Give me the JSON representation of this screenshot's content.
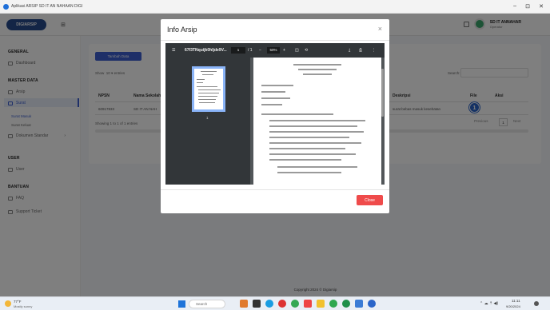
{
  "window": {
    "title": "Aplikasi ARSIP SD IT AN NAHAAN DIGI",
    "controls": [
      "–",
      "⊡",
      "✕"
    ]
  },
  "header": {
    "logo_text": "DIGIARSIP",
    "logo_sub": "⊞",
    "user_name": "SD IT ANNAHAR",
    "user_role": "Operator"
  },
  "sidebar": {
    "sections": [
      {
        "head": "GENERAL",
        "items": [
          "Dashboard"
        ]
      },
      {
        "head": "MASTER DATA",
        "items": [
          "Arsip",
          "Surat"
        ]
      },
      {
        "head": "USER",
        "items": [
          "User"
        ]
      },
      {
        "head": "BANTUAN",
        "items": [
          "FAQ",
          "Support Ticket"
        ]
      }
    ],
    "sub_items": [
      "Surat Masuk",
      "Surat Keluar",
      "Dokumen Standar"
    ]
  },
  "main": {
    "add_button": "Tambah Data",
    "show_label": "Show",
    "show_value": "10",
    "entries_label": "entries",
    "search_label": "Search:",
    "columns": [
      "NPSN",
      "Nama Sekolah",
      "Deskripsi",
      "File",
      "Aksi"
    ],
    "row": {
      "npsn": "60917833",
      "nama": "SD IT AN NAH",
      "deskripsi": "surat bebas masuk kesehatan"
    },
    "info": "Showing 1 to 1 of 1 entries",
    "prev": "Previous",
    "page": "1",
    "next": "Next",
    "badge": "1",
    "footer": "Copyright 2024 © Digiarsip"
  },
  "modal": {
    "title": "Info Arsip",
    "close_x": "×",
    "close_button": "Close",
    "viewer": {
      "filename": "67f3TNquijk0hljde9V...",
      "page_current": "1",
      "page_total": "/ 1",
      "zoom": "50%",
      "thumb_page": "1"
    }
  },
  "taskbar": {
    "weather_temp": "77°F",
    "weather_desc": "Mostly sunny",
    "search_placeholder": "Search",
    "time": "11:11",
    "date": "9/20/2024"
  },
  "colors": {
    "accent": "#3c5fd1",
    "danger": "#ef4b4b",
    "viewer_bg": "#525659",
    "viewer_bar": "#323639"
  }
}
